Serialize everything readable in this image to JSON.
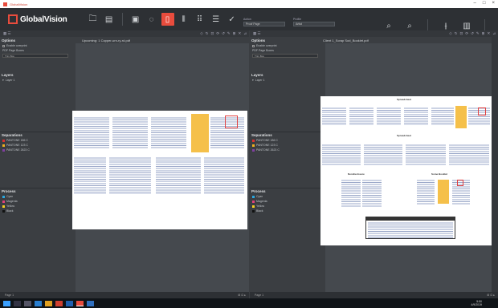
{
  "window": {
    "title": "GlobalVision"
  },
  "app": {
    "logo_text": "GlobalVision"
  },
  "toolbar": {
    "profile_label": "Action",
    "profile_value": "Proof Page",
    "mode_label": "Profile",
    "mode_value": "Artist"
  },
  "left_panel": {
    "doc_title": "Upcoming: 1 Copper-urn-ry-rd.pdf",
    "options_title": "Options",
    "enable_overprint": "Enable overprint",
    "pdf_page_boxes": "PDF Page Boxes",
    "page_box_value": "Trim Box",
    "layers_title": "Layers",
    "layer_1": "Layer 1",
    "separations_title": "Separations",
    "separations": [
      "PANTONE 186 C",
      "PANTONE 123 C",
      "PANTONE 2623 C"
    ],
    "process_title": "Process",
    "process": [
      "Cyan",
      "Magenta",
      "Yellow",
      "Black"
    ],
    "status_page": "Page 1"
  },
  "right_panel": {
    "doc_title": "Client 1_Scrap Sod_Booklet.pdf",
    "options_title": "Options",
    "enable_overprint": "Enable overprint",
    "pdf_page_boxes": "PDF Page Boxes",
    "page_box_value": "Trim Box",
    "layers_title": "Layers",
    "layer_1": "Layer 1",
    "separations_title": "Separations",
    "separations": [
      "PANTONE 186 C",
      "PANTONE 123 C",
      "PANTONE 2623 C"
    ],
    "process_title": "Process",
    "process": [
      "Cyan",
      "Magenta",
      "Yellow",
      "Black"
    ],
    "status_page": "Page 1",
    "page_headers": [
      "Spreadsheet",
      "Spreadsheet",
      "Nondisclosure",
      "Some Booklet"
    ]
  },
  "colors": {
    "accent": "#e84c3d",
    "cyan": "#29a8e0",
    "magenta": "#e0407a",
    "yellow": "#f5d020",
    "black": "#111111",
    "sep1": "#d83030",
    "sep2": "#f0b020",
    "sep3": "#8040a0"
  },
  "taskbar": {
    "time": "5:50",
    "date": "4/9/2019"
  }
}
